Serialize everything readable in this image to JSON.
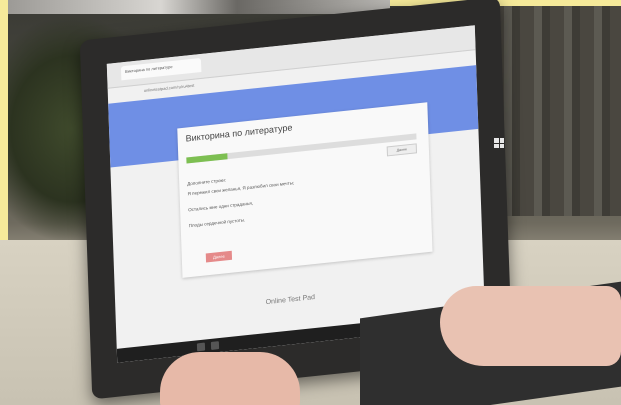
{
  "browser": {
    "tab_label": "Викторина по литературе",
    "address": "onlinetestpad.com/ru/ru4test"
  },
  "quiz": {
    "title": "Викторина по литературе",
    "progress_fraction": 0.18,
    "next_label": "Далее",
    "questions": [
      "Дополните строки:",
      "Я пережил свои желанья, Я разлюбил свои мечты;",
      "Остались мне одни страданья,",
      "Плоды сердечной пустоты."
    ],
    "submit_label": "Далее"
  },
  "footer": {
    "logo_text": "Online Test Pad"
  },
  "colors": {
    "banner": "#6f8fe5",
    "progress": "#7dbf52",
    "submit": "#e58a8a"
  }
}
